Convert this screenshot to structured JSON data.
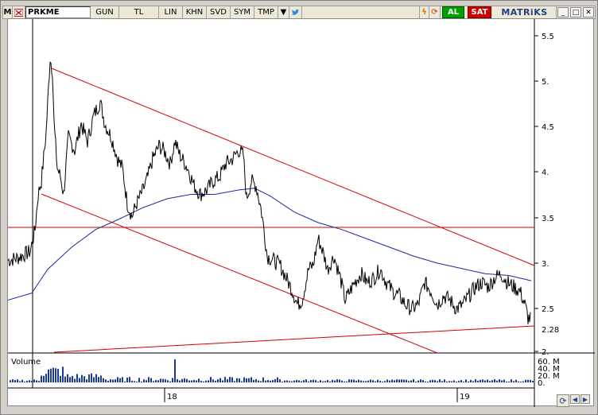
{
  "toolbar": {
    "menu_label": "M",
    "symbol": "PRKME",
    "buttons": [
      "GUN",
      "TL",
      "LIN",
      "KHN",
      "SVD",
      "SYM",
      "TMP"
    ],
    "buy_label": "AL",
    "sell_label": "SAT",
    "logo": "MATRiKS",
    "icons": [
      "close-icon",
      "dropdown-icon",
      "twitter-bird-icon",
      "flash-icon",
      "refresh-icon",
      "minimize-icon",
      "maximize-icon",
      "close-window-icon"
    ]
  },
  "chart_data": {
    "type": "line",
    "series": [
      {
        "kind": "price",
        "color": "#000000"
      },
      {
        "kind": "moving-average",
        "color": "#1a2a9a"
      }
    ],
    "y_ticks": [
      "5.5",
      "5.",
      "4.5",
      "4.",
      "3.5",
      "3.",
      "2.5",
      "2."
    ],
    "last_price_label": "2.28",
    "ylim": [
      2.0,
      5.6
    ],
    "x_ticks": [
      "18",
      "19"
    ],
    "volume": {
      "label": "Volume",
      "y_ticks": [
        "60. M",
        "40. M",
        "20. M",
        "0."
      ],
      "color": "#1a3a9a"
    },
    "trendline_color": "#d00000"
  },
  "nav": {
    "refresh_icon": "refresh-icon",
    "left": "left-arrow-icon",
    "right": "right-arrow-icon"
  }
}
